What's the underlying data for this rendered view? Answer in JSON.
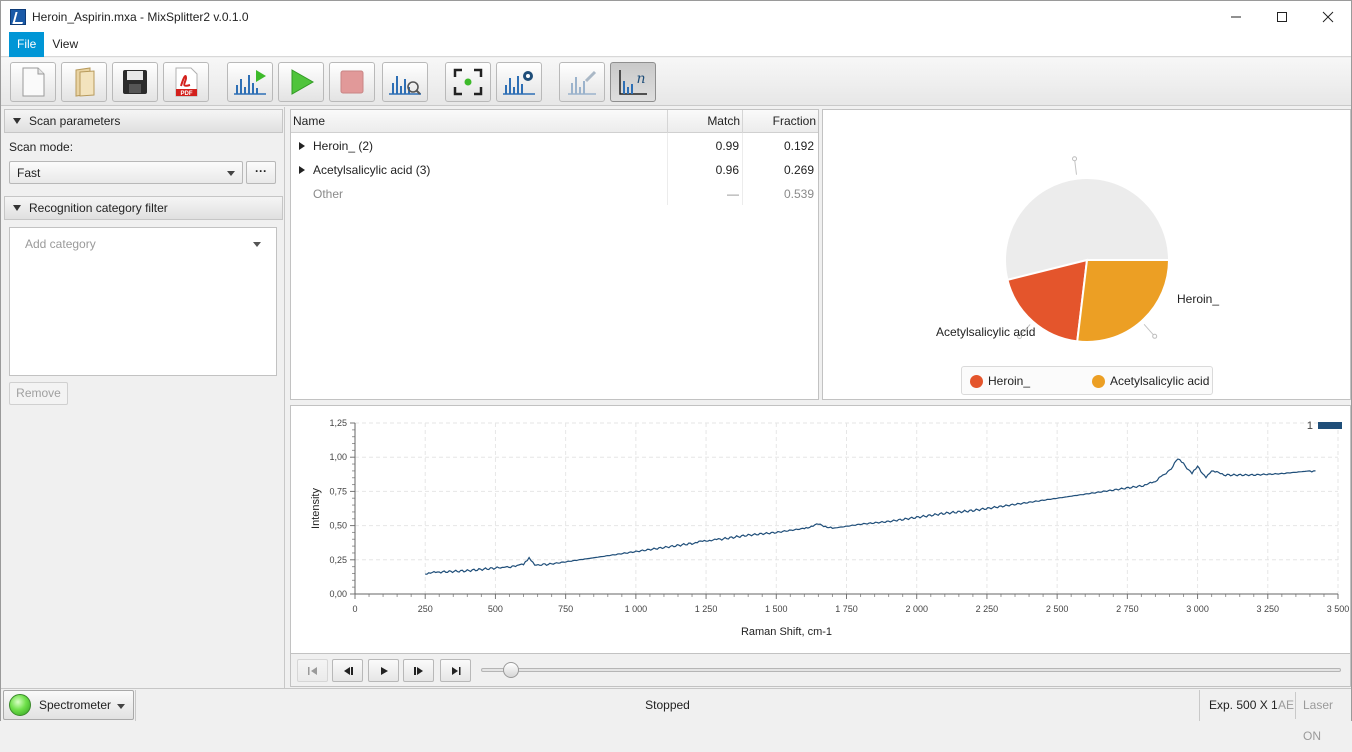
{
  "window": {
    "title": "Heroin_Aspirin.mxa - MixSplitter2 v.0.1.0",
    "controls": {
      "minimize": "—",
      "maximize": "☐",
      "close": "✕"
    }
  },
  "menu": {
    "file": "File",
    "view": "View"
  },
  "toolbar": {
    "buttons": [
      "new-document",
      "open-folder",
      "save",
      "export-pdf",
      "acquire-spectrum",
      "run",
      "stop",
      "analyze-spectrum",
      "capture-frame",
      "spectrum-settings",
      "spectrum-tool-disabled",
      "normalize-toggle"
    ]
  },
  "left_panel": {
    "scan_section": "Scan parameters",
    "scan_mode_label": "Scan mode:",
    "scan_mode_value": "Fast",
    "dots": "···",
    "category_section": "Recognition category filter",
    "category_placeholder": "Add category",
    "remove_label": "Remove"
  },
  "results": {
    "columns": {
      "name": "Name",
      "match": "Match",
      "fraction": "Fraction"
    },
    "rows": [
      {
        "name": "Heroin_ (2)",
        "match": "0.99",
        "fraction": "0.192"
      },
      {
        "name": "Acetylsalicylic acid (3)",
        "match": "0.96",
        "fraction": "0.269"
      },
      {
        "name": "Other",
        "match": "—",
        "fraction": "0.539"
      }
    ]
  },
  "pie": {
    "slices": [
      {
        "label": "Other",
        "fraction": 0.539,
        "color": "#ececec"
      },
      {
        "label": "Heroin_",
        "fraction": 0.192,
        "color": "#e4552c"
      },
      {
        "label": "Acetylsalicylic acid",
        "fraction": 0.269,
        "color": "#ec9f24"
      }
    ],
    "label_heroin": "Heroin_",
    "label_aspirin": "Acetylsalicylic acid",
    "legend": [
      {
        "name": "Heroin_",
        "color": "#e4552c"
      },
      {
        "name": "Acetylsalicylic acid",
        "color": "#ec9f24"
      }
    ]
  },
  "spectrum": {
    "xlabel": "Raman Shift, cm-1",
    "ylabel": "Intensity",
    "legend_label": "1",
    "line_color": "#1f4e79",
    "x_ticks": [
      "0",
      "250",
      "500",
      "750",
      "1 000",
      "1 250",
      "1 500",
      "1 750",
      "2 000",
      "2 250",
      "2 500",
      "2 750",
      "3 000",
      "3 250",
      "3 500"
    ],
    "y_ticks": [
      "0,00",
      "0,25",
      "0,50",
      "0,75",
      "1,00",
      "1,25"
    ]
  },
  "chart_data": {
    "type": "line",
    "xlabel": "Raman Shift, cm-1",
    "ylabel": "Intensity",
    "xlim": [
      0,
      3500
    ],
    "ylim": [
      0,
      1.25
    ],
    "grid": true,
    "legend_placement": "top-right",
    "series": [
      {
        "name": "1",
        "x": [
          250,
          300,
          400,
          500,
          560,
          600,
          620,
          640,
          700,
          800,
          900,
          1000,
          1100,
          1200,
          1250,
          1300,
          1400,
          1500,
          1600,
          1650,
          1700,
          1800,
          1900,
          2000,
          2100,
          2200,
          2300,
          2400,
          2500,
          2600,
          2700,
          2800,
          2850,
          2870,
          2900,
          2930,
          2950,
          2980,
          3000,
          3030,
          3050,
          3100,
          3200,
          3300,
          3400,
          3420
        ],
        "y": [
          0.15,
          0.16,
          0.17,
          0.19,
          0.2,
          0.22,
          0.26,
          0.21,
          0.22,
          0.25,
          0.28,
          0.31,
          0.34,
          0.37,
          0.39,
          0.4,
          0.43,
          0.45,
          0.48,
          0.51,
          0.48,
          0.51,
          0.53,
          0.56,
          0.59,
          0.61,
          0.64,
          0.67,
          0.7,
          0.73,
          0.76,
          0.79,
          0.82,
          0.86,
          0.9,
          0.99,
          0.95,
          0.88,
          0.93,
          0.85,
          0.9,
          0.87,
          0.87,
          0.88,
          0.9,
          0.9
        ]
      }
    ]
  },
  "playback": {
    "buttons": [
      "first",
      "step-back",
      "play",
      "step-forward",
      "last"
    ],
    "position": 0.035
  },
  "status": {
    "device": "Spectrometer",
    "state": "Stopped",
    "exposure": "Exp. 500 X 1",
    "ae": "AE",
    "laser": "Laser ON"
  }
}
